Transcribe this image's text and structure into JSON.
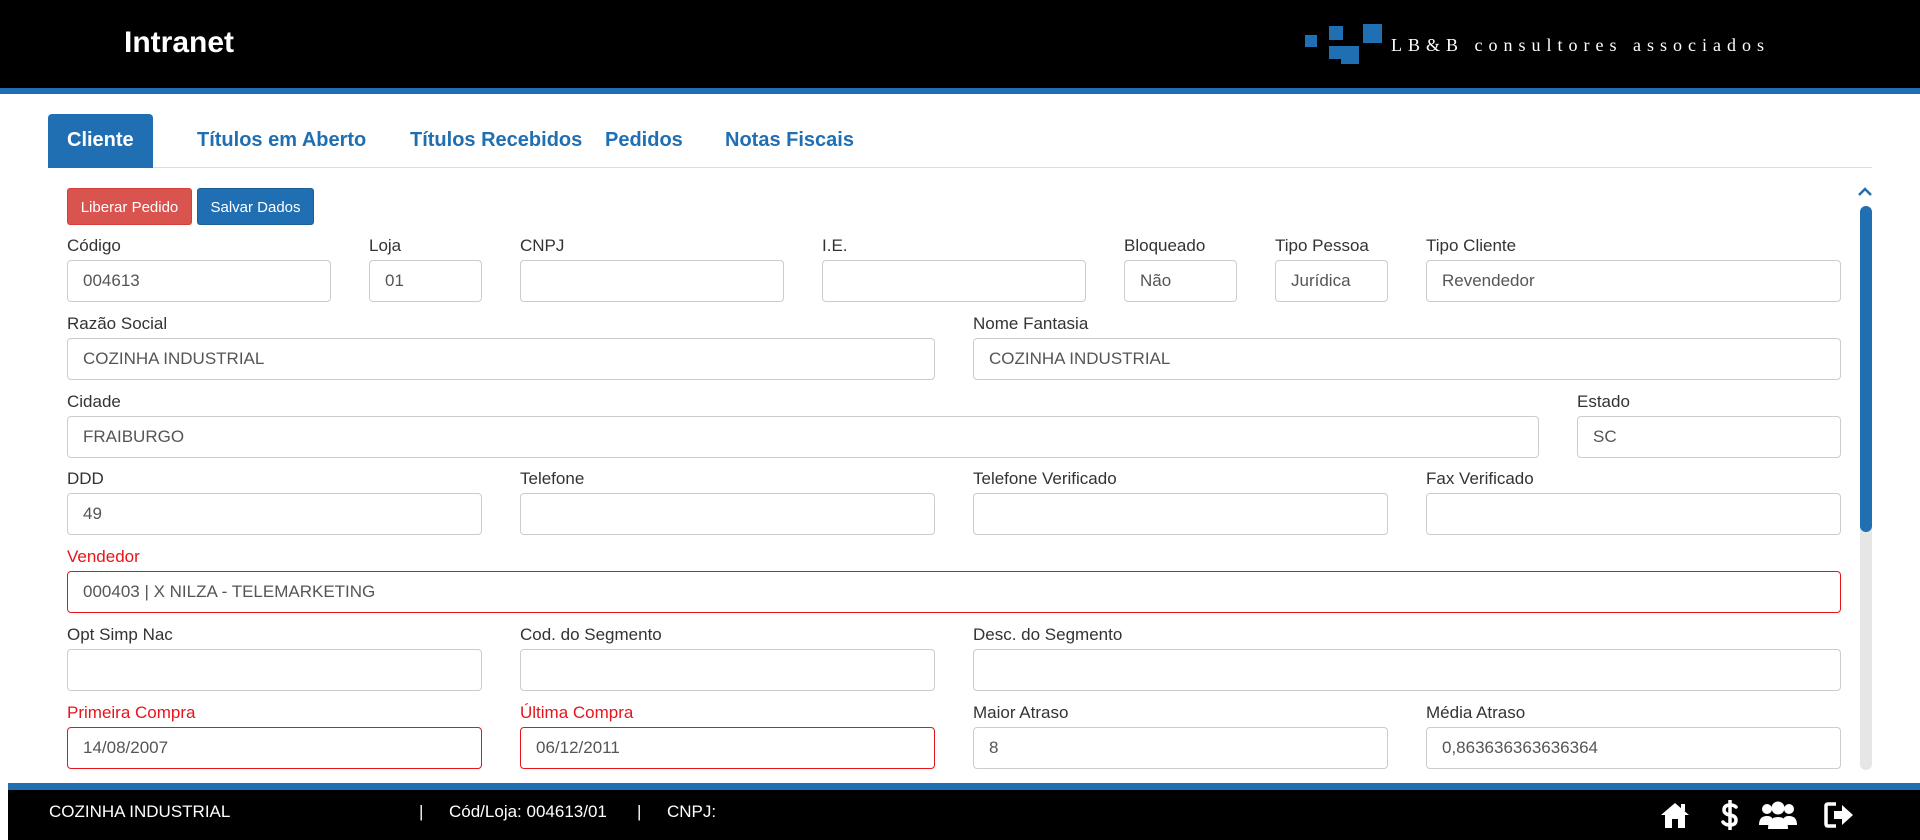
{
  "header": {
    "title": "Intranet",
    "logo_text": "LB&B consultores associados"
  },
  "tabs": [
    {
      "label": "Cliente",
      "active": true
    },
    {
      "label": "Títulos em Aberto",
      "active": false
    },
    {
      "label": "Títulos Recebidos",
      "active": false
    },
    {
      "label": "Pedidos",
      "active": false
    },
    {
      "label": "Notas Fiscais",
      "active": false
    }
  ],
  "actions": {
    "liberar_label": "Liberar Pedido",
    "salvar_label": "Salvar Dados"
  },
  "form": {
    "codigo": {
      "label": "Código",
      "value": "004613"
    },
    "loja": {
      "label": "Loja",
      "value": "01"
    },
    "cnpj": {
      "label": "CNPJ",
      "value": ""
    },
    "ie": {
      "label": "I.E.",
      "value": ""
    },
    "bloqueado": {
      "label": "Bloqueado",
      "value": "Não"
    },
    "tipo_pessoa": {
      "label": "Tipo Pessoa",
      "value": "Jurídica"
    },
    "tipo_cliente": {
      "label": "Tipo Cliente",
      "value": "Revendedor"
    },
    "razao_social": {
      "label": "Razão Social",
      "value": "COZINHA INDUSTRIAL"
    },
    "nome_fantasia": {
      "label": "Nome Fantasia",
      "value": "COZINHA INDUSTRIAL"
    },
    "cidade": {
      "label": "Cidade",
      "value": "FRAIBURGO"
    },
    "estado": {
      "label": "Estado",
      "value": "SC"
    },
    "ddd": {
      "label": "DDD",
      "value": "49"
    },
    "telefone": {
      "label": "Telefone",
      "value": ""
    },
    "telefone_verificado": {
      "label": "Telefone Verificado",
      "value": ""
    },
    "fax_verificado": {
      "label": "Fax Verificado",
      "value": ""
    },
    "vendedor": {
      "label": "Vendedor",
      "value": "000403 | X NILZA - TELEMARKETING"
    },
    "opt_simp_nac": {
      "label": "Opt Simp Nac",
      "value": ""
    },
    "cod_segmento": {
      "label": "Cod. do Segmento",
      "value": ""
    },
    "desc_segmento": {
      "label": "Desc. do Segmento",
      "value": ""
    },
    "primeira_compra": {
      "label": "Primeira Compra",
      "value": "14/08/2007"
    },
    "ultima_compra": {
      "label": "Última Compra",
      "value": "06/12/2011"
    },
    "maior_atraso": {
      "label": "Maior Atraso",
      "value": "8"
    },
    "media_atraso": {
      "label": "Média Atraso",
      "value": "0,863636363636364"
    }
  },
  "footer": {
    "client_name": "COZINHA INDUSTRIAL",
    "separator": "|",
    "cod_loja": "Cód/Loja: 004613/01",
    "cnpj": "CNPJ:",
    "icons": [
      "home-icon",
      "dollar-icon",
      "users-icon",
      "sign-out-icon"
    ]
  },
  "colors": {
    "brand_blue": "#1f6fb2",
    "danger": "#d9534f",
    "required_red": "#e8141b",
    "bar_black": "#000000"
  }
}
